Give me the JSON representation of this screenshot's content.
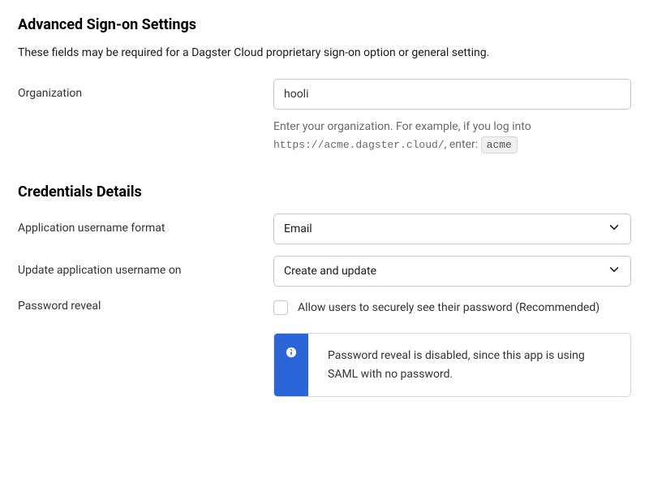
{
  "advanced": {
    "heading": "Advanced Sign-on Settings",
    "description": "These fields may be required for a Dagster Cloud proprietary sign-on option or general setting.",
    "organization": {
      "label": "Organization",
      "value": "hooli",
      "help_prefix": "Enter your organization. For example, if you log into ",
      "help_url": "https://acme.dagster.cloud/",
      "help_mid": ", enter: ",
      "help_chip": "acme"
    }
  },
  "credentials": {
    "heading": "Credentials Details",
    "username_format": {
      "label": "Application username format",
      "value": "Email"
    },
    "update_on": {
      "label": "Update application username on",
      "value": "Create and update"
    },
    "password_reveal": {
      "label": "Password reveal",
      "checkbox_label": "Allow users to securely see their password (Recommended)",
      "info": "Password reveal is disabled, since this app is using SAML with no password."
    }
  }
}
